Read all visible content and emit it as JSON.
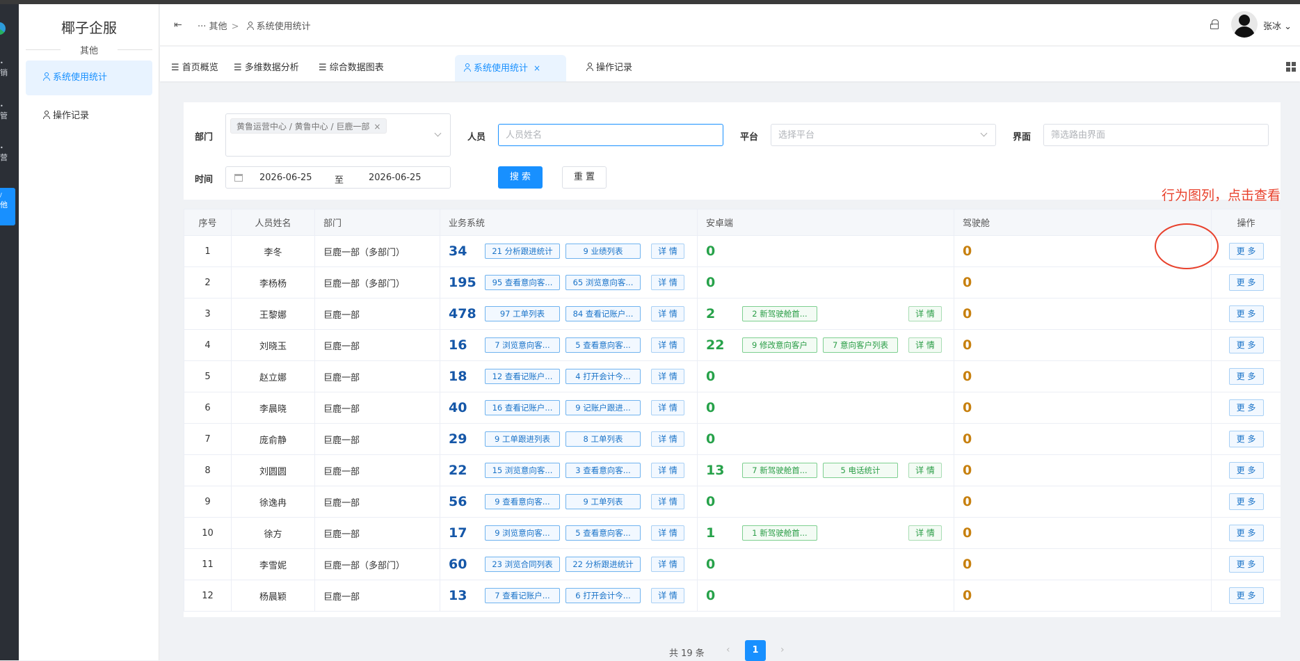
{
  "rail": {
    "items": [
      "销",
      "管",
      "营",
      "他"
    ]
  },
  "sidebar": {
    "brand": "椰子企服",
    "section": "其他",
    "items": [
      {
        "label": "系统使用统计",
        "active": true
      },
      {
        "label": "操作记录",
        "active": false
      }
    ]
  },
  "header": {
    "breadcrumb": [
      "···",
      "其他",
      "系统使用统计"
    ],
    "user": "张冰"
  },
  "tabs": [
    {
      "label": "首页概览"
    },
    {
      "label": "多维数据分析"
    },
    {
      "label": "综合数据图表"
    },
    {
      "label": "系统使用统计",
      "active": true,
      "close": "×"
    },
    {
      "label": "操作记录"
    }
  ],
  "filters": {
    "dept_label": "部门",
    "dept_tag": "黄鲁运营中心 / 黄鲁中心 / 巨鹿一部",
    "person_label": "人员",
    "person_placeholder": "人员姓名",
    "platform_label": "平台",
    "platform_placeholder": "选择平台",
    "page_label": "界面",
    "page_placeholder": "筛选路由界面",
    "time_label": "时间",
    "date_start": "2026-06-25",
    "date_to": "至",
    "date_end": "2026-06-25",
    "search_btn": "搜 索",
    "reset_btn": "重 置"
  },
  "annotation": "行为图列，点击查看",
  "table": {
    "headers": [
      "序号",
      "人员姓名",
      "部门",
      "业务系统",
      "安卓端",
      "驾驶舱",
      "操作"
    ],
    "detail_label": "详 情",
    "more_label": "更 多",
    "rows": [
      {
        "no": "1",
        "name": "李冬",
        "dept": "巨鹿一部（多部门）",
        "biz": "34",
        "biz_tags": [
          "21 分析跟进统计",
          "9 业绩列表"
        ],
        "android": "0",
        "android_tags": [],
        "cockpit": "0"
      },
      {
        "no": "2",
        "name": "李杨杨",
        "dept": "巨鹿一部（多部门）",
        "biz": "195",
        "biz_tags": [
          "95 查看意向客...",
          "65 浏览意向客..."
        ],
        "android": "0",
        "android_tags": [],
        "cockpit": "0"
      },
      {
        "no": "3",
        "name": "王黎娜",
        "dept": "巨鹿一部",
        "biz": "478",
        "biz_tags": [
          "97 工单列表",
          "84 查看记账户..."
        ],
        "android": "2",
        "android_tags": [
          "2 新驾驶舱首..."
        ],
        "cockpit": "0"
      },
      {
        "no": "4",
        "name": "刘晓玉",
        "dept": "巨鹿一部",
        "biz": "16",
        "biz_tags": [
          "7 浏览意向客...",
          "5 查看意向客..."
        ],
        "android": "22",
        "android_tags": [
          "9 修改意向客户",
          "7 意向客户列表"
        ],
        "cockpit": "0"
      },
      {
        "no": "5",
        "name": "赵立娜",
        "dept": "巨鹿一部",
        "biz": "18",
        "biz_tags": [
          "12 查看记账户...",
          "4 打开会计今..."
        ],
        "android": "0",
        "android_tags": [],
        "cockpit": "0"
      },
      {
        "no": "6",
        "name": "李晨晓",
        "dept": "巨鹿一部",
        "biz": "40",
        "biz_tags": [
          "16 查看记账户...",
          "9 记账户跟进..."
        ],
        "android": "0",
        "android_tags": [],
        "cockpit": "0"
      },
      {
        "no": "7",
        "name": "庞俞静",
        "dept": "巨鹿一部",
        "biz": "29",
        "biz_tags": [
          "9 工单跟进列表",
          "8 工单列表"
        ],
        "android": "0",
        "android_tags": [],
        "cockpit": "0"
      },
      {
        "no": "8",
        "name": "刘圆圆",
        "dept": "巨鹿一部",
        "biz": "22",
        "biz_tags": [
          "15 浏览意向客...",
          "3 查看意向客..."
        ],
        "android": "13",
        "android_tags": [
          "7 新驾驶舱首...",
          "5 电话统计"
        ],
        "cockpit": "0"
      },
      {
        "no": "9",
        "name": "徐逸冉",
        "dept": "巨鹿一部",
        "biz": "56",
        "biz_tags": [
          "9 查看意向客...",
          "9 工单列表"
        ],
        "android": "0",
        "android_tags": [],
        "cockpit": "0"
      },
      {
        "no": "10",
        "name": "徐方",
        "dept": "巨鹿一部",
        "biz": "17",
        "biz_tags": [
          "9 浏览意向客...",
          "5 查看意向客..."
        ],
        "android": "1",
        "android_tags": [
          "1 新驾驶舱首..."
        ],
        "cockpit": "0"
      },
      {
        "no": "11",
        "name": "李雪妮",
        "dept": "巨鹿一部（多部门）",
        "biz": "60",
        "biz_tags": [
          "23 浏览合同列表",
          "22 分析跟进统计"
        ],
        "android": "0",
        "android_tags": [],
        "cockpit": "0"
      },
      {
        "no": "12",
        "name": "杨晨颖",
        "dept": "巨鹿一部",
        "biz": "13",
        "biz_tags": [
          "7 查看记账户...",
          "6 打开会计今..."
        ],
        "android": "0",
        "android_tags": [],
        "cockpit": "0"
      }
    ]
  },
  "pager": {
    "total": "共 19 条",
    "prev": "‹",
    "page": "1",
    "next": "›"
  }
}
